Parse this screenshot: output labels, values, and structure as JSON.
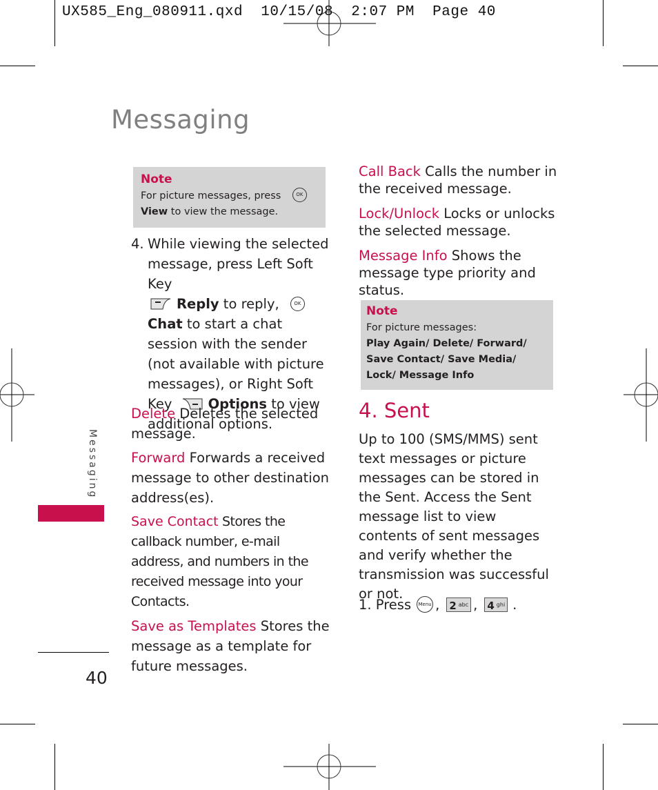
{
  "slug": "UX585_Eng_080911.qxd  10/15/08  2:07 PM  Page 40",
  "page_title": "Messaging",
  "side_tab": "Messaging",
  "page_number": "40",
  "accent_color": "#c8104c",
  "left_column": {
    "note": {
      "title": "Note",
      "line1": "For picture messages, press",
      "icon": "OK",
      "bold": "View",
      "line2": " to view the message."
    },
    "step4": {
      "number": "4.",
      "part1": "While viewing the selected message, press Left Soft Key",
      "reply_label": "Reply",
      "part2": " to reply,",
      "ok_icon": "OK",
      "chat_label": "Chat",
      "part3": " to start a chat session with the sender (not available with picture messages), or Right Soft Key",
      "options_label": "Options",
      "part4": " to view additional options."
    },
    "options": [
      {
        "term": "Delete",
        "desc": " Deletes the selected message."
      },
      {
        "term": "Forward",
        "desc": " Forwards a received message to other destination address(es)."
      },
      {
        "term": "Save Contact",
        "desc": " Stores the callback number, e-mail address, and numbers in the received message into your Contacts."
      },
      {
        "term": "Save as Templates",
        "desc": " Stores the message as a template for future messages."
      }
    ]
  },
  "right_column": {
    "options": [
      {
        "term": "Call Back",
        "desc": " Calls the number in the received message."
      },
      {
        "term": "Lock/Unlock",
        "desc": " Locks or unlocks the selected message."
      },
      {
        "term": "Message Info",
        "desc": " Shows the message type priority and status."
      }
    ],
    "note": {
      "title": "Note",
      "line1": "For picture messages:",
      "bold": "Play Again/ Delete/ Forward/ Save Contact/ Save Media/ Lock/ Message Info"
    },
    "section_heading": "4. Sent",
    "section_body": "Up to 100 (SMS/MMS) sent text messages or picture messages can be stored in the Sent. Access the Sent message list to view contents of sent messages and verify whether the transmission was successful or not.",
    "step1": {
      "label": "1. Press",
      "menu_icon": "Menu",
      "key1_num": "2",
      "key1_letters": "abc",
      "key2_num": "4",
      "key2_letters": "ghi",
      "sep": ",",
      "end": "."
    }
  }
}
